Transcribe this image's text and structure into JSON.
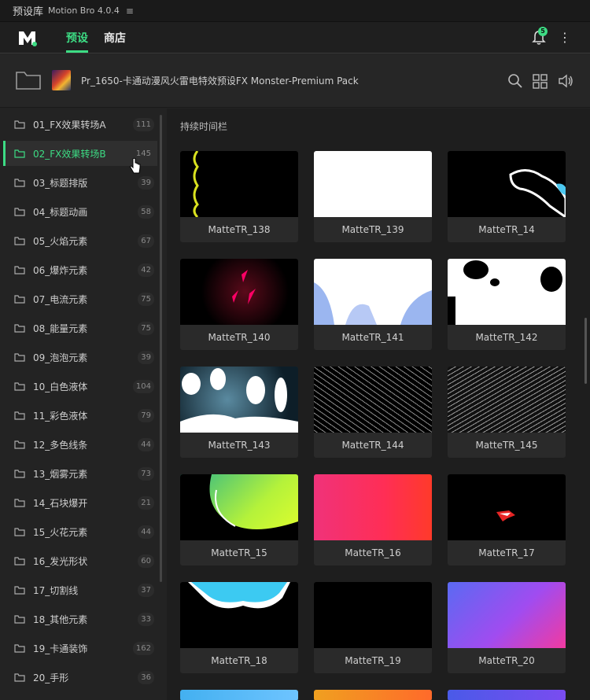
{
  "titlebar": {
    "app": "预设库",
    "product": "Motion Bro 4.0.4",
    "menu_icon": "hamburger-icon"
  },
  "nav": {
    "tab_presets": "预设",
    "tab_store": "商店",
    "notification_count": "5"
  },
  "pack": {
    "title": "Pr_1650-卡通动漫风火雷电特效预设FX Monster-Premium Pack"
  },
  "categories": [
    {
      "label": "01_FX效果转场A",
      "count": "111"
    },
    {
      "label": "02_FX效果转场B",
      "count": "145"
    },
    {
      "label": "03_标题排版",
      "count": "39"
    },
    {
      "label": "04_标题动画",
      "count": "58"
    },
    {
      "label": "05_火焰元素",
      "count": "67"
    },
    {
      "label": "06_爆炸元素",
      "count": "42"
    },
    {
      "label": "07_电流元素",
      "count": "75"
    },
    {
      "label": "08_能量元素",
      "count": "75"
    },
    {
      "label": "09_泡泡元素",
      "count": "39"
    },
    {
      "label": "10_白色液体",
      "count": "104"
    },
    {
      "label": "11_彩色液体",
      "count": "79"
    },
    {
      "label": "12_多色线条",
      "count": "44"
    },
    {
      "label": "13_烟雾元素",
      "count": "73"
    },
    {
      "label": "14_石块爆开",
      "count": "21"
    },
    {
      "label": "15_火花元素",
      "count": "44"
    },
    {
      "label": "16_发光形状",
      "count": "60"
    },
    {
      "label": "17_切割线",
      "count": "37"
    },
    {
      "label": "18_其他元素",
      "count": "33"
    },
    {
      "label": "19_卡通装饰",
      "count": "162"
    },
    {
      "label": "20_手形",
      "count": "36"
    }
  ],
  "selected_category": "02_FX效果转场B",
  "section_title": "持续时间栏",
  "presets": [
    {
      "name": "MatteTR_138"
    },
    {
      "name": "MatteTR_139"
    },
    {
      "name": "MatteTR_14"
    },
    {
      "name": "MatteTR_140"
    },
    {
      "name": "MatteTR_141"
    },
    {
      "name": "MatteTR_142"
    },
    {
      "name": "MatteTR_143"
    },
    {
      "name": "MatteTR_144"
    },
    {
      "name": "MatteTR_145"
    },
    {
      "name": "MatteTR_15"
    },
    {
      "name": "MatteTR_16"
    },
    {
      "name": "MatteTR_17"
    },
    {
      "name": "MatteTR_18"
    },
    {
      "name": "MatteTR_19"
    },
    {
      "name": "MatteTR_20"
    }
  ],
  "colors": {
    "accent": "#3ddc84",
    "panel": "#232323",
    "grid_bg": "#1e1e1e",
    "card": "#2a2a2a"
  },
  "icons": [
    "folder-icon",
    "search-icon",
    "grid-view-icon",
    "sound-icon",
    "bell-icon",
    "more-vertical-icon",
    "motion-bro-logo-icon"
  ]
}
